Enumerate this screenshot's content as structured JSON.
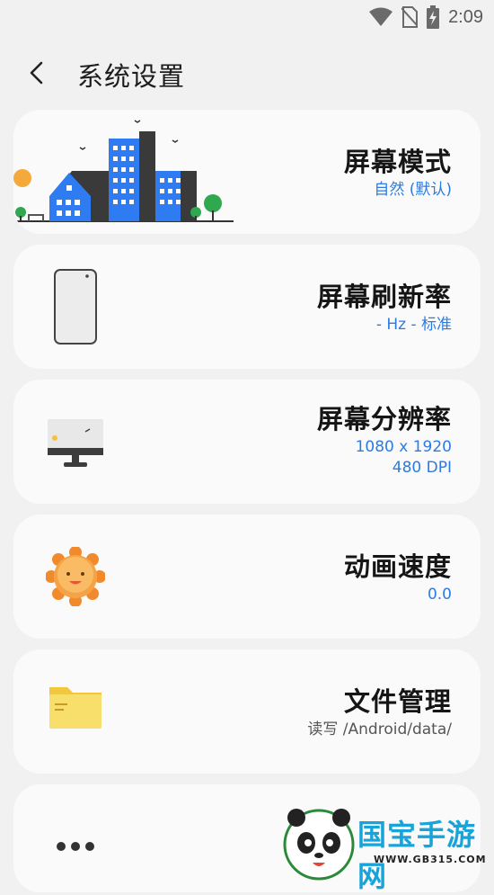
{
  "status": {
    "time": "2:09",
    "icons": [
      "wifi-icon",
      "no-sim-icon",
      "battery-charging-icon"
    ]
  },
  "header": {
    "title": "系统设置",
    "back_icon": "back-arrow-icon"
  },
  "cards": [
    {
      "title": "屏幕模式",
      "sub": [
        "自然 (默认)"
      ],
      "icon": "city-illustration-icon"
    },
    {
      "title": "屏幕刷新率",
      "sub": [
        "- Hz - 标准"
      ],
      "icon": "phone-icon"
    },
    {
      "title": "屏幕分辨率",
      "sub": [
        "1080 x 1920",
        "480 DPI"
      ],
      "icon": "monitor-icon"
    },
    {
      "title": "动画速度",
      "sub": [
        "0.0"
      ],
      "icon": "sun-face-icon"
    },
    {
      "title": "文件管理",
      "sub": [
        "读写 /Android/data/"
      ],
      "icon": "folder-icon"
    },
    {
      "title": "",
      "sub": [],
      "icon": "more-dots-icon"
    }
  ],
  "watermark": {
    "brand": "国宝手游网",
    "url": "WWW.GB315.COM"
  },
  "colors": {
    "accent": "#2d7be0",
    "background": "#f1f1f1",
    "card": "#fafafa"
  }
}
